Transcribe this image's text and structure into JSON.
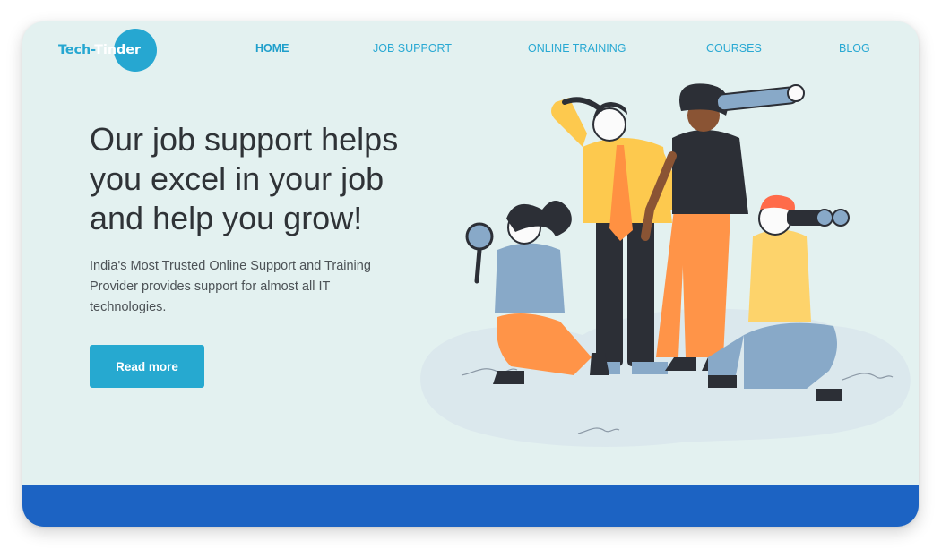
{
  "brand": {
    "logo_part1": "Tech-",
    "logo_part2": "Tinder"
  },
  "nav": {
    "items": [
      {
        "label": "HOME",
        "active": true
      },
      {
        "label": "JOB SUPPORT",
        "active": false
      },
      {
        "label": "ONLINE TRAINING",
        "active": false
      },
      {
        "label": "COURSES",
        "active": false
      },
      {
        "label": "BLOG",
        "active": false
      }
    ]
  },
  "hero": {
    "headline": "Our job support helps you excel in your job and help you grow!",
    "subtext": "India's Most Trusted Online Support and Training Provider provides support for almost all IT technologies.",
    "cta_label": "Read more"
  },
  "colors": {
    "background": "#e3f1f0",
    "accent": "#26a9d0",
    "footer_band": "#1c63c3"
  }
}
